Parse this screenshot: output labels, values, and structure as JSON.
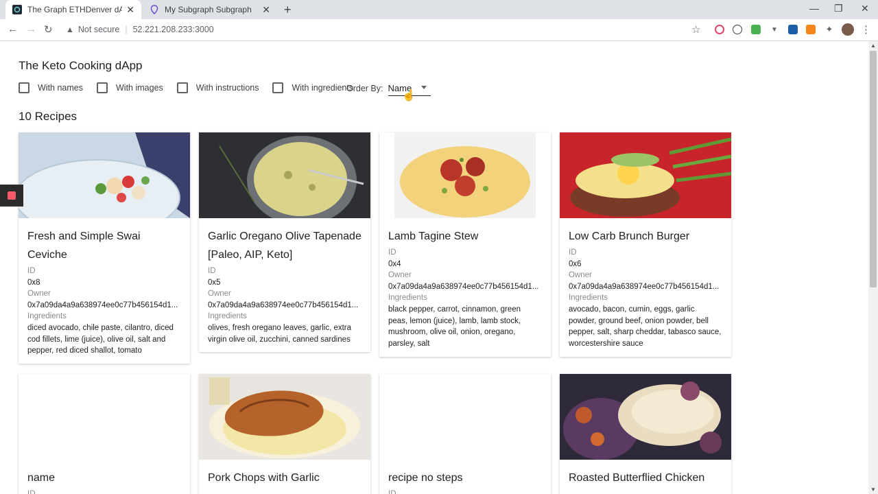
{
  "browser": {
    "tabs": [
      {
        "title": "The Graph ETHDenver dApp",
        "active": true
      },
      {
        "title": "My Subgraph Subgraph",
        "active": false
      }
    ],
    "security_label": "Not secure",
    "url": "52.221.208.233:3000"
  },
  "app": {
    "title": "The Keto Cooking dApp",
    "filters": [
      "With names",
      "With images",
      "With instructions",
      "With ingredients"
    ],
    "order_by_label": "Order By:",
    "order_by_value": "Name",
    "recipe_count": "10 Recipes"
  },
  "labels": {
    "id": "ID",
    "owner": "Owner",
    "ingredients": "Ingredients"
  },
  "recipes": [
    {
      "name": "Fresh and Simple Swai Ceviche",
      "id": "0x8",
      "owner": "0x7a09da4a9a638974ee0c77b456154d1...",
      "ingredients": "diced avocado, chile paste, cilantro, diced cod fillets, lime (juice), olive oil, salt and pepper, red diced shallot, tomato"
    },
    {
      "name": "Garlic Oregano Olive Tapenade [Paleo, AIP, Keto]",
      "id": "0x5",
      "owner": "0x7a09da4a9a638974ee0c77b456154d1...",
      "ingredients": "olives, fresh oregano leaves, garlic, extra virgin olive oil, zucchini, canned sardines"
    },
    {
      "name": "Lamb Tagine Stew",
      "id": "0x4",
      "owner": "0x7a09da4a9a638974ee0c77b456154d1...",
      "ingredients": "black pepper, carrot, cinnamon, green peas, lemon (juice), lamb, lamb stock, mushroom, olive oil, onion, oregano, parsley, salt"
    },
    {
      "name": "Low Carb Brunch Burger",
      "id": "0x6",
      "owner": "0x7a09da4a9a638974ee0c77b456154d1...",
      "ingredients": "avocado, bacon, cumin, eggs, garlic powder, ground beef, onion powder, bell pepper, salt, sharp cheddar, tabasco sauce, worcestershire sauce"
    },
    {
      "name": "name",
      "id_label": "ID"
    },
    {
      "name": "Pork Chops with Garlic"
    },
    {
      "name": "recipe no steps",
      "id_label": "ID"
    },
    {
      "name": "Roasted Butterflied Chicken"
    }
  ]
}
